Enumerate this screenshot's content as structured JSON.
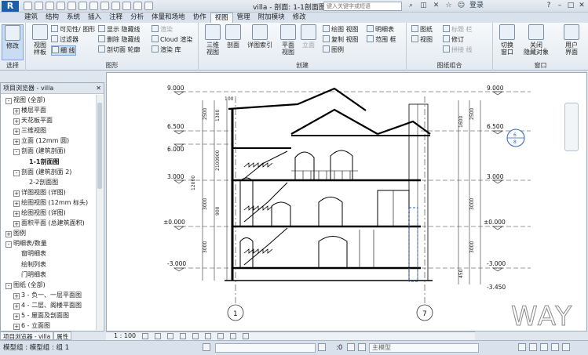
{
  "app": {
    "logo": "R",
    "title": "villa - 剖面: 1-1剖面图"
  },
  "search": {
    "placeholder": "键入关键字或短语"
  },
  "account": {
    "login": "登录"
  },
  "ribbon_tabs": [
    "建筑",
    "结构",
    "系统",
    "插入",
    "注释",
    "分析",
    "体量和场地",
    "协作",
    "视图",
    "管理",
    "附加模块",
    "修改"
  ],
  "active_tab": "视图",
  "ribbon": {
    "select": {
      "modify": "修改",
      "label": "选择"
    },
    "graphics": {
      "label": "图形",
      "view_template": "视图\n样板",
      "items": [
        "可见性/ 图形",
        "过滤器",
        "细 线",
        "显示 隐藏线",
        "删除 隐藏线",
        "剖切面 轮廓"
      ]
    },
    "render": {
      "items": [
        "渲染",
        "Cloud 渲染",
        "渲染 库"
      ]
    },
    "create": {
      "label": "创建",
      "buttons": [
        "三维\n视图",
        "剖面",
        "详图索引",
        "平面\n视图",
        "立面"
      ],
      "items": [
        "绘图 视图",
        "复制 视图",
        "图例",
        "明细表",
        "范围 框"
      ]
    },
    "sheet": {
      "label": "图纸组合",
      "items": [
        "图纸",
        "视图",
        "修订",
        "标题 栏",
        "拼接 线"
      ]
    },
    "window": {
      "label": "窗口",
      "buttons": [
        "切换\n窗口",
        "关闭\n隐藏对象",
        "用户\n界面"
      ]
    }
  },
  "project_browser": {
    "title": "项目浏览器 - villa",
    "items": [
      {
        "label": "视图 (全部)",
        "level": 0,
        "exp": "-"
      },
      {
        "label": "楼层平面",
        "level": 1,
        "exp": "+"
      },
      {
        "label": "天花板平面",
        "level": 1,
        "exp": "+"
      },
      {
        "label": "三维视图",
        "level": 1,
        "exp": "+"
      },
      {
        "label": "立面 (12mm 圆)",
        "level": 1,
        "exp": "+"
      },
      {
        "label": "剖面 (建筑剖面)",
        "level": 1,
        "exp": "-"
      },
      {
        "label": "1-1剖面图",
        "level": 2,
        "exp": "",
        "bold": true
      },
      {
        "label": "剖面 (建筑剖面 2)",
        "level": 1,
        "exp": "-"
      },
      {
        "label": "2-2剖面图",
        "level": 2,
        "exp": ""
      },
      {
        "label": "详图视图 (详图)",
        "level": 1,
        "exp": "+"
      },
      {
        "label": "绘图视图 (12mm 标头)",
        "level": 1,
        "exp": "+"
      },
      {
        "label": "绘图视图 (详图)",
        "level": 1,
        "exp": "+"
      },
      {
        "label": "面积平面 (总建筑面积)",
        "level": 1,
        "exp": "+"
      },
      {
        "label": "图例",
        "level": 0,
        "exp": "+"
      },
      {
        "label": "明细表/数量",
        "level": 0,
        "exp": "-"
      },
      {
        "label": "窗明细表",
        "level": 1,
        "exp": ""
      },
      {
        "label": "绘制列表",
        "level": 1,
        "exp": ""
      },
      {
        "label": "门明细表",
        "level": 1,
        "exp": ""
      },
      {
        "label": "图纸 (全部)",
        "level": 0,
        "exp": "-"
      },
      {
        "label": "3 - 负一、一层平面图",
        "level": 1,
        "exp": "+"
      },
      {
        "label": "4 - 二层、阁楼平面图",
        "level": 1,
        "exp": "+"
      },
      {
        "label": "5 - 屋面及剖面图",
        "level": 1,
        "exp": "+"
      },
      {
        "label": "6 - 立面图",
        "level": 1,
        "exp": "+"
      }
    ],
    "tabs": [
      "项目浏览器 - villa",
      "属性"
    ]
  },
  "drawing": {
    "levels_left": [
      "9.000",
      "6.500",
      "6.000",
      "3.000",
      "±0.000",
      "-3.000"
    ],
    "levels_right": [
      "9.000",
      "6.500",
      "3.000",
      "±0.000",
      "-3.000",
      "-3.450"
    ],
    "grid_1": "1",
    "grid_7": "7",
    "callout_top": "6",
    "callout_bottom": "8",
    "watermark": "WAY",
    "dims": [
      "2500",
      "1300",
      "900",
      "2100",
      "900",
      "3000",
      "3000",
      "12000",
      "2500",
      "3000",
      "3000",
      "450",
      "1600",
      "100"
    ]
  },
  "view_control": {
    "scale": "1 : 100"
  },
  "status": {
    "text": "模型组 : 模型组 : 组 1",
    "zero": ":0",
    "model": "主模型"
  }
}
